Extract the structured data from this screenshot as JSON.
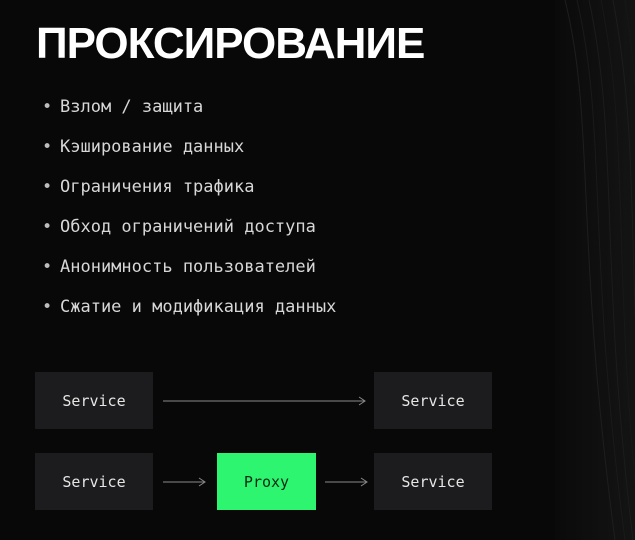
{
  "slide": {
    "title": "ПРОКСИРОВАНИЕ",
    "bullet_marker": "•",
    "bullets": [
      "Взлом / защита",
      "Кэширование данных",
      "Ограничения трафика",
      "Обход ограничений доступа",
      "Анонимность пользователей",
      "Сжатие и модификация данных"
    ]
  },
  "diagram": {
    "direct_row": {
      "left": "Service",
      "right": "Service"
    },
    "proxy_row": {
      "left": "Service",
      "middle": "Proxy",
      "right": "Service"
    }
  },
  "colors": {
    "background": "#080808",
    "box": "#1c1c1e",
    "proxy_box": "#2df56f",
    "arrow": "#8a8a8a",
    "text": "#d7d7d7"
  }
}
